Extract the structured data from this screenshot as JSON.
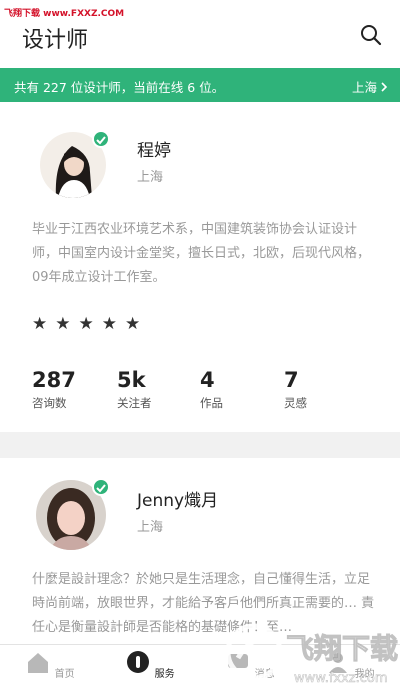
{
  "watermark_top": "飞翔下载 www.FXXZ.COM",
  "header": {
    "title": "设计师"
  },
  "banner": {
    "message": "共有 227 位设计师，当前在线 6 位。",
    "city": "上海"
  },
  "designers": [
    {
      "name": "程婷",
      "location": "上海",
      "bio": "毕业于江西农业环境艺术系，中国建筑装饰协会认证设计师，中国室内设计金堂奖，擅长日式，北欧，后现代风格，09年成立设计工作室。",
      "rating": 5,
      "stats": [
        {
          "value": "287",
          "label": "咨询数"
        },
        {
          "value": "5k",
          "label": "关注者"
        },
        {
          "value": "4",
          "label": "作品"
        },
        {
          "value": "7",
          "label": "灵感"
        }
      ]
    },
    {
      "name": "Jenny熾月",
      "location": "上海",
      "bio": "什麼是設計理念？於她只是生活理念，自己懂得生活，立足時尚前端，放眼世界，才能給予客戶他們所真正需要的… 責任心是衡量設計師是否能格的基礎條件！至…"
    }
  ],
  "tabbar": [
    {
      "label": "首页",
      "icon": "home-icon"
    },
    {
      "label": "服务",
      "icon": "service-icon"
    },
    {
      "label": "消息",
      "icon": "message-icon"
    },
    {
      "label": "我的",
      "icon": "profile-icon"
    }
  ],
  "watermark_logo": {
    "text": "飞翔下载",
    "url": "www.fxxz.com"
  },
  "colors": {
    "accent": "#2fb37a",
    "watermark": "#d4122a"
  }
}
